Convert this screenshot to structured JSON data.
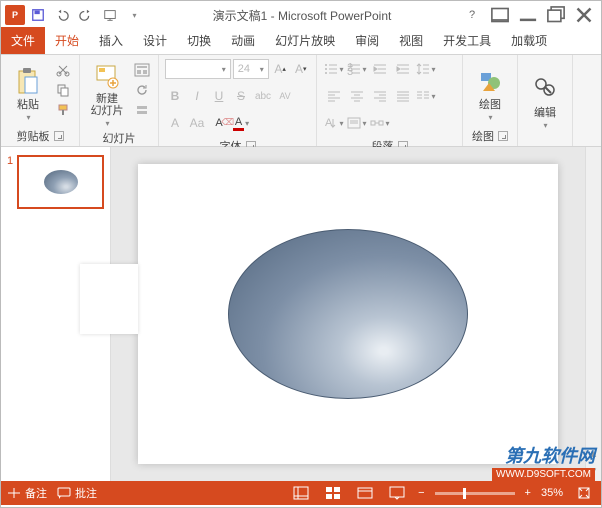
{
  "title": "演示文稿1 - Microsoft PowerPoint",
  "app_badge": "P",
  "tabs": {
    "file": "文件",
    "items": [
      "开始",
      "插入",
      "设计",
      "切换",
      "动画",
      "幻灯片放映",
      "审阅",
      "视图",
      "开发工具",
      "加载项"
    ],
    "active_index": 0
  },
  "ribbon": {
    "clipboard": {
      "paste": "粘贴",
      "label": "剪贴板"
    },
    "slides": {
      "new": "新建\n幻灯片",
      "label": "幻灯片"
    },
    "font": {
      "size_placeholder": "24",
      "bold": "B",
      "italic": "I",
      "underline": "U",
      "strike": "S",
      "shadow": "abc",
      "spacing": "AV",
      "grow": "A",
      "shrink": "Aa",
      "clear": "A",
      "label": "字体"
    },
    "paragraph": {
      "label": "段落"
    },
    "drawing": {
      "btn": "绘图",
      "label": "绘图"
    },
    "editing": {
      "btn": "编辑",
      "label": "编辑"
    }
  },
  "thumbs": {
    "num": "1"
  },
  "status": {
    "notes": "备注",
    "comments": "批注",
    "zoom": "35%",
    "zoom_minus": "−",
    "zoom_plus": "+"
  },
  "watermark": {
    "l1": "第九软件网",
    "l2": "WWW.D9SOFT.COM"
  }
}
